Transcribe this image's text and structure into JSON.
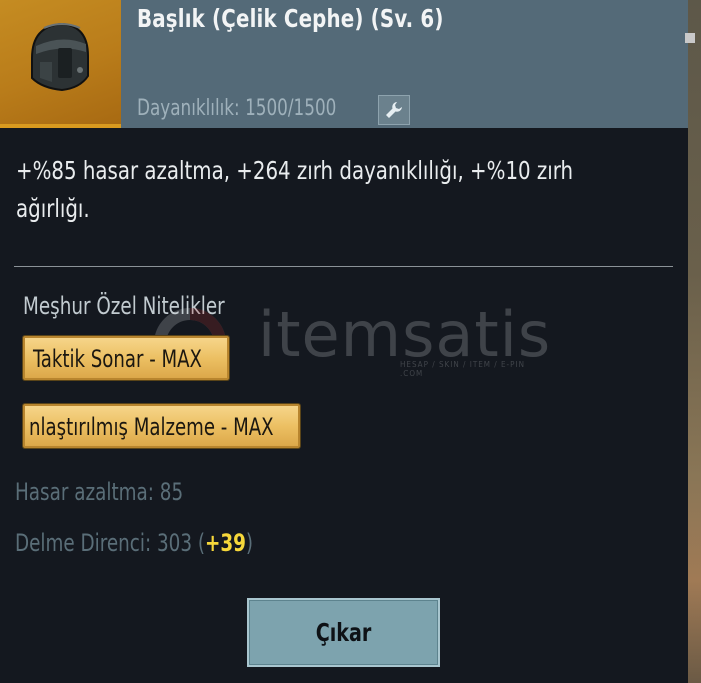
{
  "item": {
    "title": "Başlık (Çelik Cephe) (Sv. 6)",
    "durability": "Dayanıklılık: 1500/1500",
    "thumbnail_icon": "helmet-icon",
    "repair_icon": "wrench-icon"
  },
  "description": "+%85 hasar azaltma, +264 zırh dayanıklılığı, +%10 zırh ağırlığı.",
  "perks": {
    "heading": "Meşhur Özel Nitelikler",
    "items": [
      {
        "label": "Taktik Sonar - MAX"
      },
      {
        "label": "nlaştırılmış Malzeme - MAX"
      }
    ]
  },
  "stats": {
    "damage_reduction": "Hasar azaltma: 85",
    "penetration_prefix": "Delme Direnci: 303 (",
    "penetration_bonus": "+39",
    "penetration_suffix": ")"
  },
  "actions": {
    "remove_label": "Çıkar"
  },
  "watermark": {
    "text": "itemsatis",
    "sub": "HESAP / SKIN / ITEM / E-PIN .COM"
  },
  "colors": {
    "header": "#546a78",
    "panel": "#14181f",
    "badge": "#ecc063",
    "bonus": "#f6d73a",
    "button": "#7da3ae"
  }
}
